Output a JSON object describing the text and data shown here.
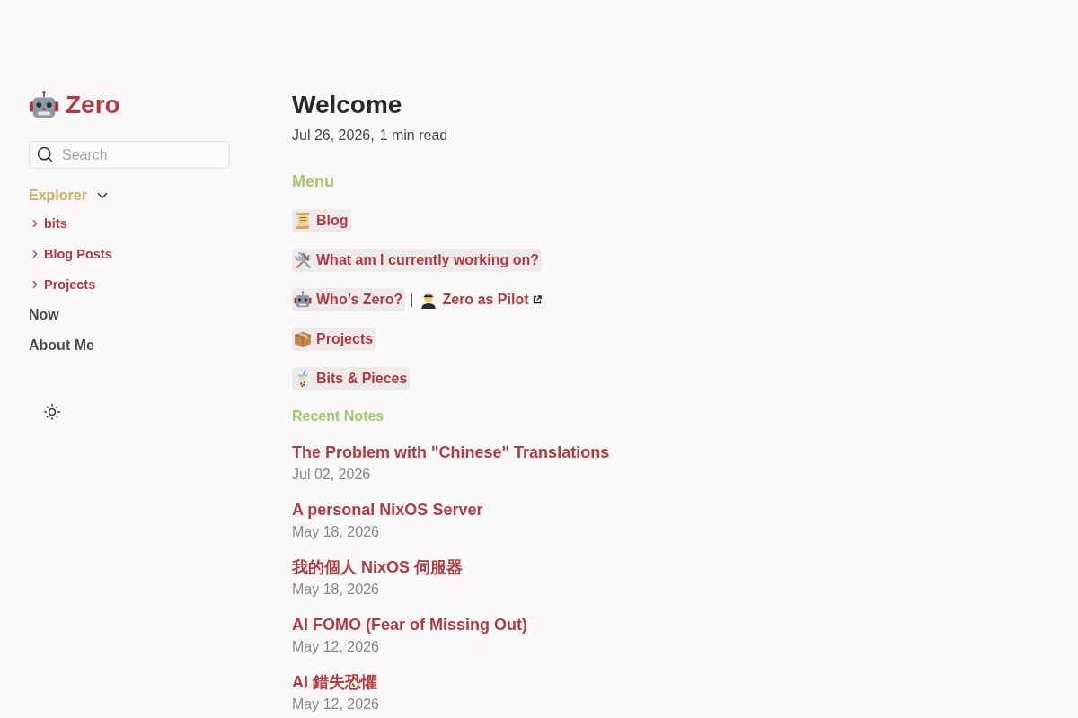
{
  "sidebar": {
    "title": "Zero",
    "search": {
      "placeholder": "Search"
    },
    "explorer": {
      "label": "Explorer",
      "expanded": true,
      "items": [
        {
          "kind": "folder",
          "label": "bits",
          "expanded": false
        },
        {
          "kind": "folder",
          "label": "Blog Posts",
          "expanded": false
        },
        {
          "kind": "folder",
          "label": "Projects",
          "expanded": false
        },
        {
          "kind": "page",
          "label": "Now"
        },
        {
          "kind": "page",
          "label": "About Me"
        }
      ]
    }
  },
  "article": {
    "title": "Welcome",
    "date": "Jul 26, 2026,",
    "reading_time": "1 min read",
    "menu": {
      "heading": "Menu",
      "rows": [
        {
          "links": [
            {
              "kind": "internal",
              "label": "Blog"
            }
          ]
        },
        {
          "links": [
            {
              "kind": "internal",
              "label": "What am I currently working on?"
            }
          ]
        },
        {
          "separator": "|",
          "links": [
            {
              "kind": "internal",
              "label": "Who’s Zero?"
            },
            {
              "kind": "external",
              "label": "Zero as Pilot"
            }
          ]
        },
        {
          "links": [
            {
              "kind": "internal",
              "label": "Projects"
            }
          ]
        },
        {
          "links": [
            {
              "kind": "internal",
              "label": "Bits & Pieces"
            }
          ]
        }
      ]
    }
  },
  "recent_notes": {
    "heading": "Recent Notes",
    "notes": [
      {
        "title": "The Problem with \"Chinese\" Translations",
        "date": "Jul 02, 2026"
      },
      {
        "title": "A personal NixOS Server",
        "date": "May 18, 2026"
      },
      {
        "title": "我的個人 NixOS 伺服器",
        "date": "May 18, 2026"
      },
      {
        "title": "AI FOMO (Fear of Missing Out)",
        "date": "May 12, 2026"
      },
      {
        "title": "AI 錯失恐懼",
        "date": "May 12, 2026"
      }
    ]
  }
}
